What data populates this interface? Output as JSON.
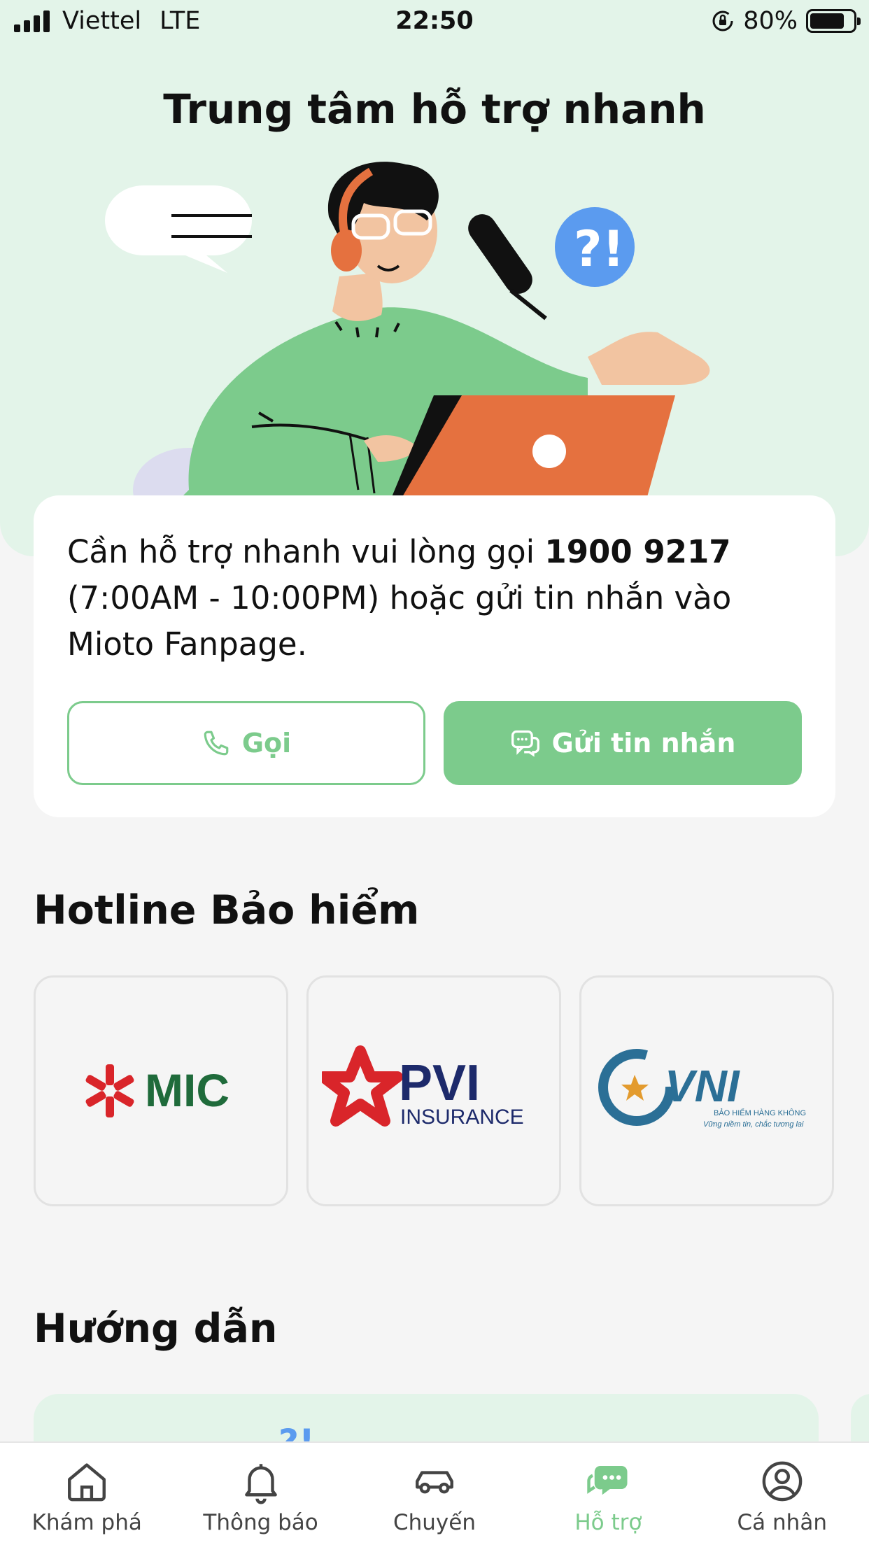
{
  "status_bar": {
    "carrier": "Viettel",
    "network": "LTE",
    "time": "22:50",
    "battery_text": "80%",
    "battery_level": 0.8
  },
  "hero": {
    "title": "Trung tâm hỗ trợ nhanh"
  },
  "support": {
    "text_before": "Cần hỗ trợ nhanh vui lòng gọi ",
    "phone": "1900 9217",
    "text_after": " (7:00AM - 10:00PM) hoặc gửi tin nhắn vào Mioto Fanpage.",
    "call_label": "Gọi",
    "message_label": "Gửi tin nhắn"
  },
  "insurance": {
    "title": "Hotline Bảo hiểm",
    "partners": [
      {
        "name": "MIC"
      },
      {
        "name": "PVI",
        "subtitle": "INSURANCE"
      },
      {
        "name": "VNI",
        "subtitle": "BẢO HIỂM HÀNG KHÔNG",
        "tagline": "Vững niềm tin, chắc tương lai"
      }
    ]
  },
  "guide": {
    "title": "Hướng dẫn"
  },
  "tabs": [
    {
      "label": "Khám phá",
      "icon": "home-icon"
    },
    {
      "label": "Thông báo",
      "icon": "bell-icon"
    },
    {
      "label": "Chuyến",
      "icon": "car-icon"
    },
    {
      "label": "Hỗ trợ",
      "icon": "chat-support-icon",
      "active": true
    },
    {
      "label": "Cá nhân",
      "icon": "user-icon"
    }
  ],
  "colors": {
    "accent": "#7ccb8c",
    "hero_bg": "#e3f4e9",
    "page_bg": "#f5f5f5",
    "laptop": "#e5713f",
    "mic_red": "#d9252a",
    "mic_green": "#1f6b3b",
    "pvi_navy": "#1d2a6b",
    "vni_blue": "#2b6f96"
  }
}
